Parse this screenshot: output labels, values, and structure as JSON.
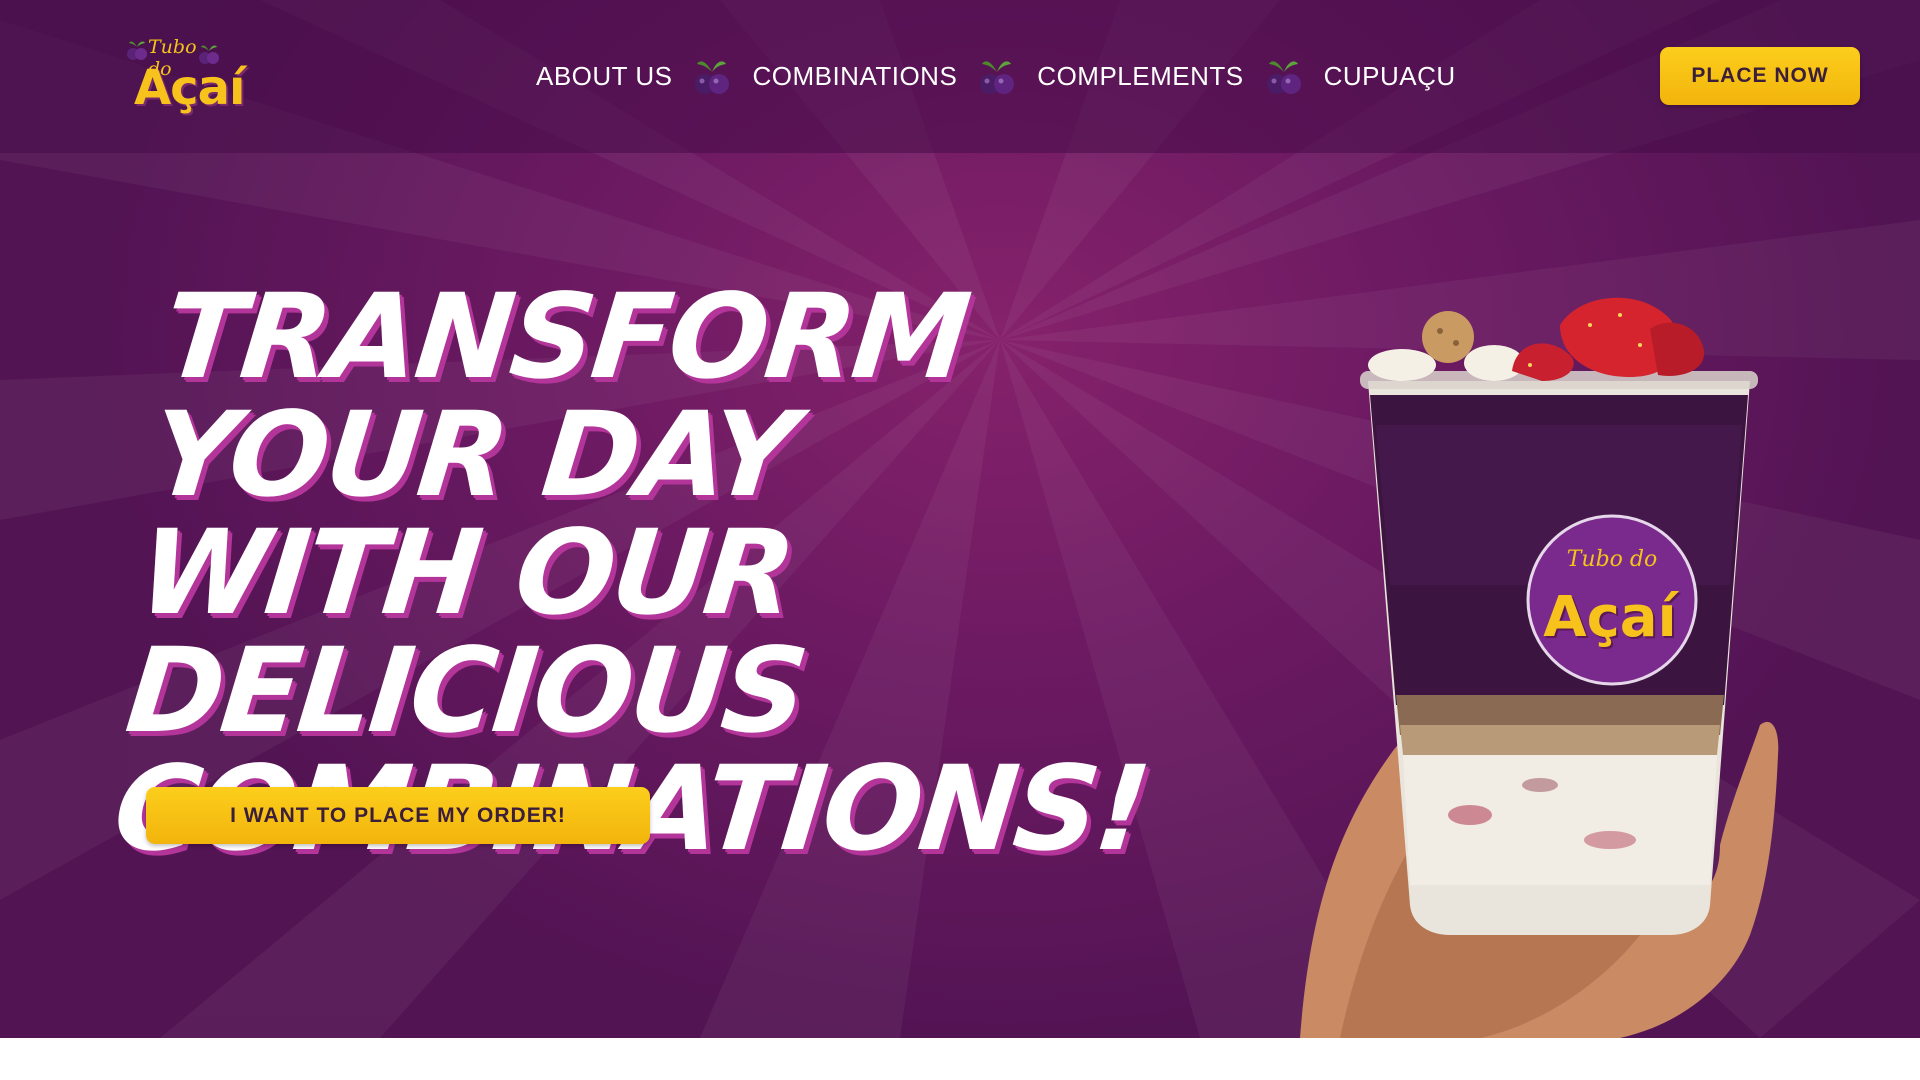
{
  "brand": {
    "script": "Tubo do",
    "name": "Açaí"
  },
  "nav": {
    "items": [
      {
        "label": "ABOUT US"
      },
      {
        "label": "COMBINATIONS"
      },
      {
        "label": "COMPLEMENTS"
      },
      {
        "label": "CUPUAÇU"
      }
    ],
    "separator_icon": "acai-berry-icon"
  },
  "header": {
    "cta_label": "PLACE NOW"
  },
  "hero": {
    "headline": "TRANSFORM YOUR DAY WITH OUR DELICIOUS COMBINATIONS!",
    "cta_label": "I WANT TO PLACE MY ORDER!"
  },
  "product": {
    "label_script": "Tubo do",
    "label_brand": "Açaí"
  },
  "colors": {
    "background": "#6d1a62",
    "accent": "#f7c21c",
    "headline_shadow": "#b3359a",
    "button_text": "#3a1e3a"
  }
}
